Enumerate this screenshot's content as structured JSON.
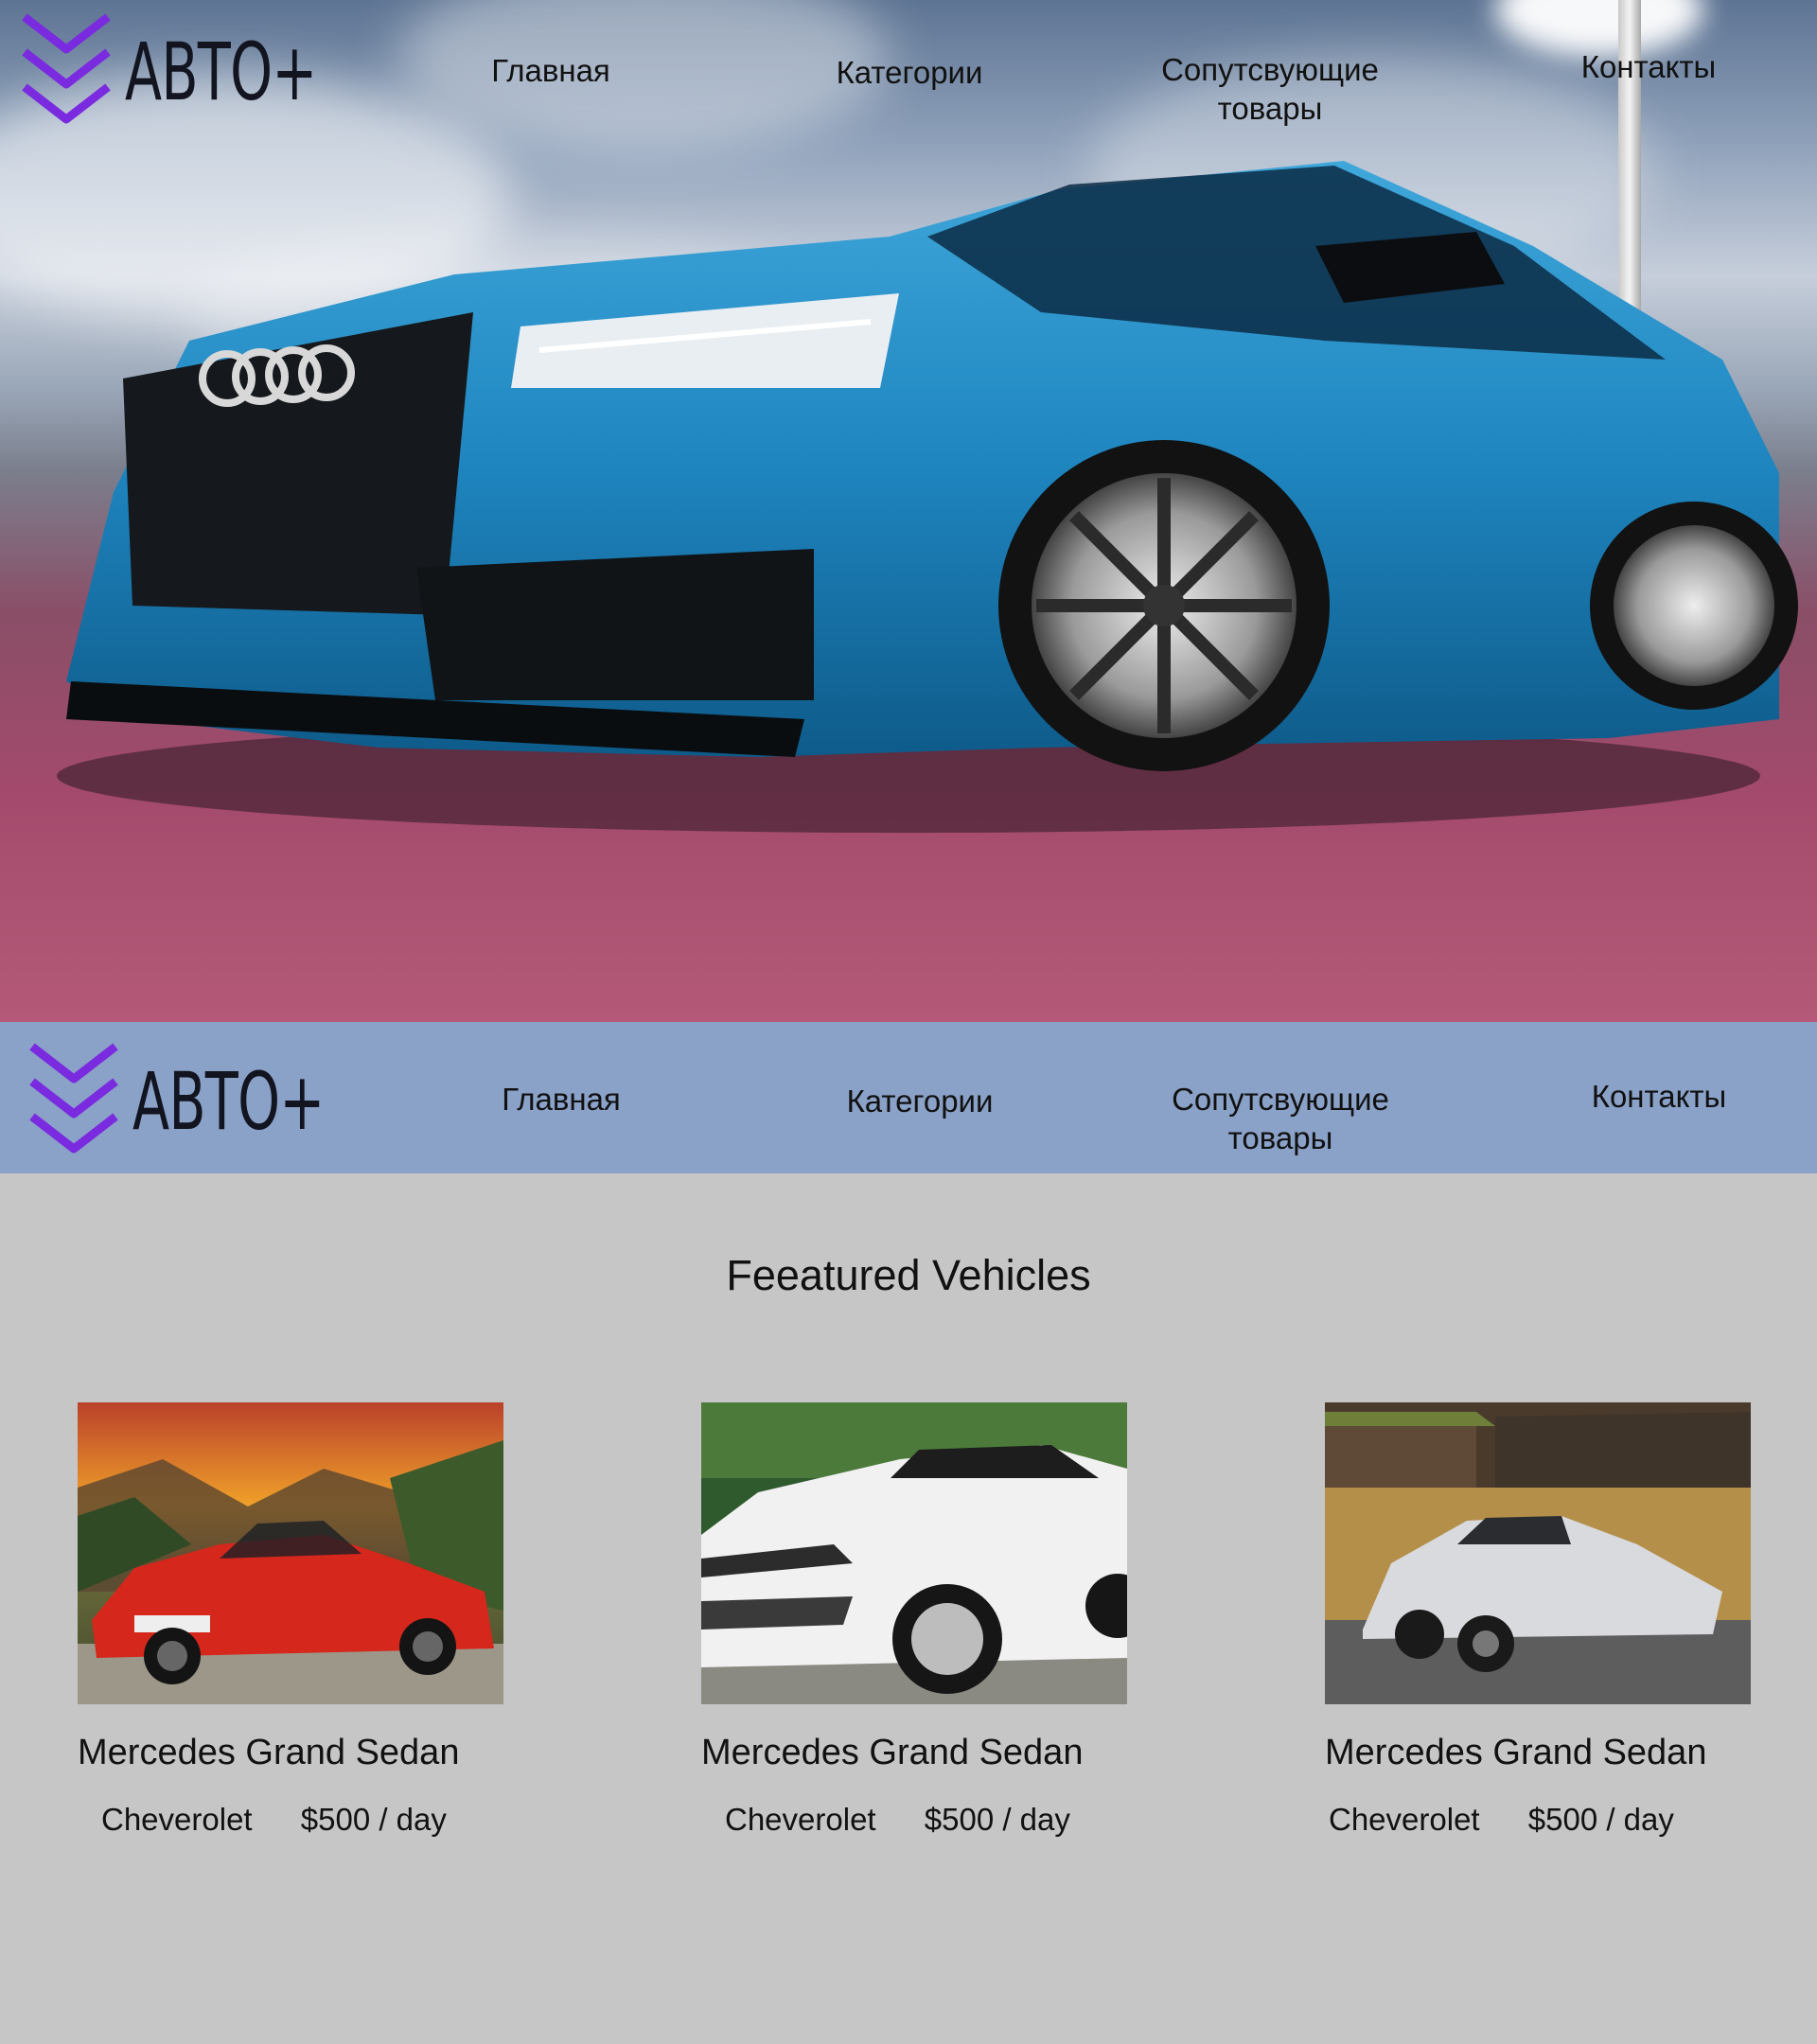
{
  "brand": {
    "name": "АВТО+"
  },
  "nav": [
    {
      "label": "Главная"
    },
    {
      "label": "Категории"
    },
    {
      "label": "Сопутсвующие\nтовары"
    },
    {
      "label": "Контакты"
    }
  ],
  "hero": {
    "image": "blue-sport-sedan-photo"
  },
  "featured": {
    "title": "Feeatured Vehicles",
    "cards": [
      {
        "image": "red-convertible-photo",
        "name": "Mercedes Grand Sedan",
        "brand": "Cheverolet",
        "price": "$500 / day"
      },
      {
        "image": "white-suv-photo",
        "name": "Mercedes Grand Sedan",
        "brand": "Cheverolet",
        "price": "$500 / day"
      },
      {
        "image": "silver-supercar-photo",
        "name": "Mercedes Grand Sedan",
        "brand": "Cheverolet",
        "price": "$500 / day"
      }
    ]
  },
  "colors": {
    "nav_bar": "#8aa1c8",
    "page_bg": "#c6c6c6",
    "logo_chevron": "#7a2bdf",
    "logo_text": "#121420"
  }
}
